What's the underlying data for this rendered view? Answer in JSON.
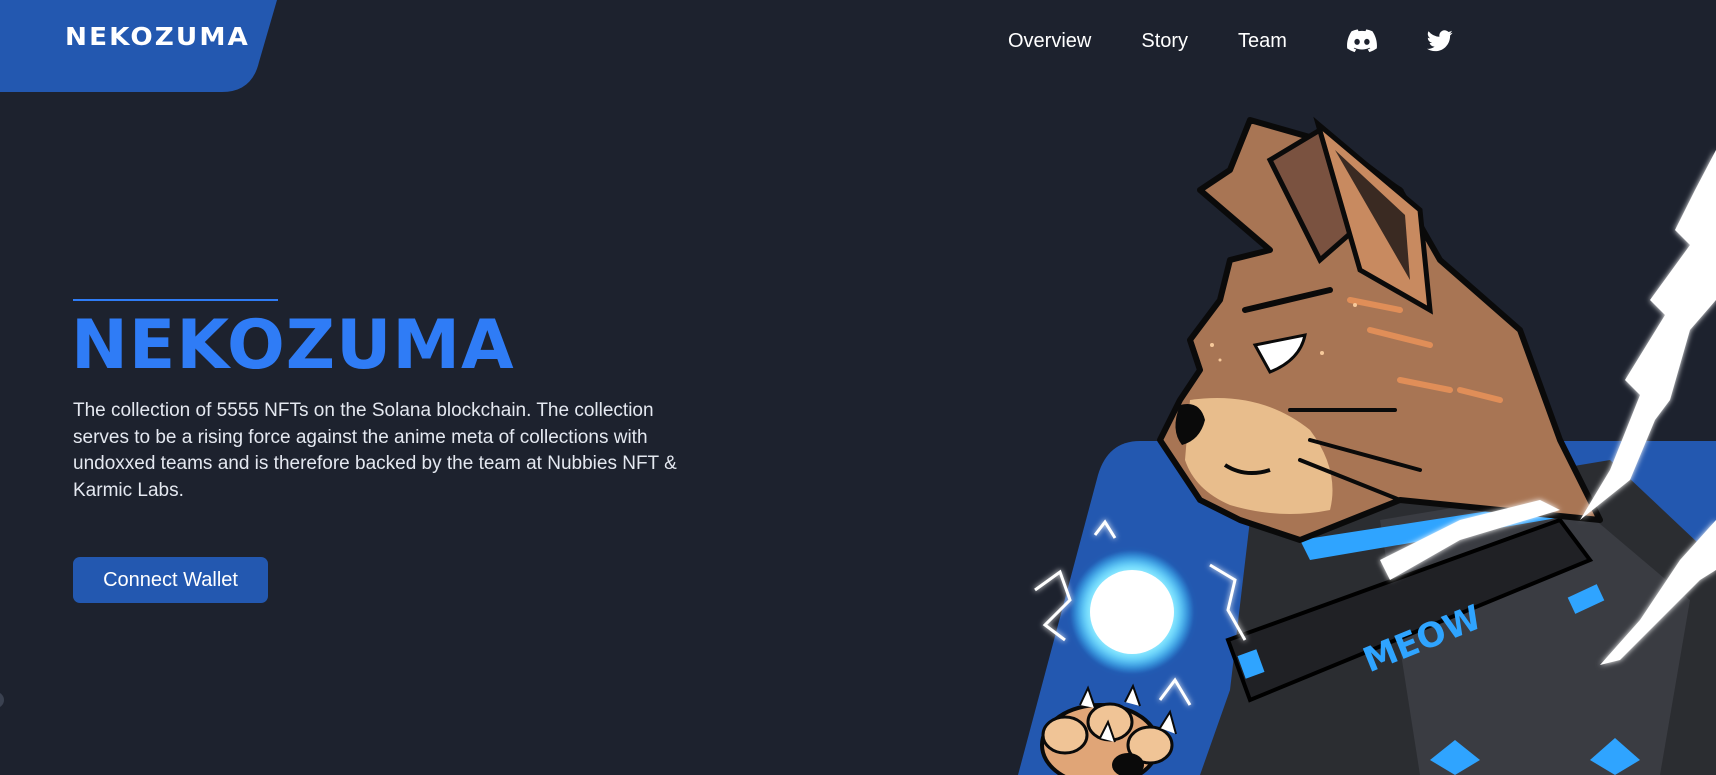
{
  "brand": {
    "logo_text": "NEKOZUMA",
    "accent_color": "#2f7cf6",
    "tab_color": "#2358b0",
    "background_color": "#1d222e"
  },
  "nav": {
    "links": [
      {
        "label": "Overview"
      },
      {
        "label": "Story"
      },
      {
        "label": "Team"
      }
    ],
    "icons": [
      "discord-icon",
      "twitter-icon"
    ]
  },
  "hero": {
    "title": "NEKOZUMA",
    "description": "The collection of 5555 NFTs on the Solana blockchain. The collection serves to be a rising force against the anime meta of collections with undoxxed teams and is therefore backed by the team at Nubbies NFT & Karmic Labs.",
    "cta_label": "Connect Wallet"
  },
  "illustration": {
    "collar_text": "MEOW"
  }
}
